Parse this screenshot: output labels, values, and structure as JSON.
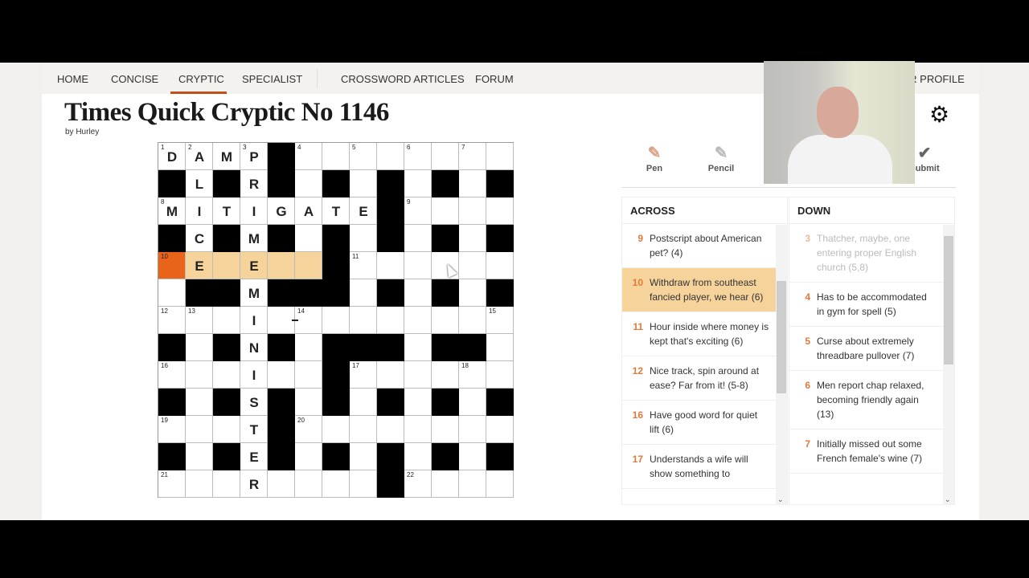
{
  "nav": {
    "items": [
      "HOME",
      "CONCISE",
      "CRYPTIC",
      "SPECIALIST",
      "CROSSWORD ARTICLES",
      "FORUM"
    ],
    "active": "CRYPTIC",
    "profile": "YOUR PROFILE"
  },
  "puzzle": {
    "title": "Times Quick Cryptic No 1146",
    "byline": "by Hurley"
  },
  "tools": {
    "pen": "Pen",
    "pencil": "Pencil",
    "submit": "Submit",
    "settings_icon": "gear-icon"
  },
  "grid": {
    "pattern": [
      "....#........",
      "#.#.#.#.#.#.#",
      "........#....",
      "#.#.#.#.#.#.#",
      "......#......",
      ".##.###.#.#.#",
      ".............",
      "#.#.#.###.##.",
      "......#......",
      "#.#.#.#.#.#.#",
      "....#........",
      "#.#.#.#.#.#.#",
      "........#...."
    ],
    "letters": {
      "0,0": "D",
      "0,1": "A",
      "0,2": "M",
      "0,3": "P",
      "1,1": "L",
      "1,3": "R",
      "2,0": "M",
      "2,1": "I",
      "2,2": "T",
      "2,3": "I",
      "2,4": "G",
      "2,5": "A",
      "2,6": "T",
      "2,7": "E",
      "3,1": "C",
      "3,3": "M",
      "4,1": "E",
      "4,3": "E",
      "5,3": "M",
      "6,3": "I",
      "7,3": "N",
      "8,3": "I",
      "9,3": "S",
      "10,3": "T",
      "11,3": "E",
      "12,3": "R"
    },
    "numbers": {
      "0,0": 1,
      "0,1": 2,
      "0,3": 3,
      "0,5": 4,
      "0,7": 5,
      "0,9": 6,
      "0,11": 7,
      "2,0": 8,
      "2,9": 9,
      "4,0": 10,
      "4,7": 11,
      "6,0": 12,
      "6,1": 13,
      "6,5": 14,
      "6,12": 15,
      "8,0": 16,
      "8,7": 17,
      "8,11": 18,
      "10,0": 19,
      "10,5": 20,
      "12,0": 21,
      "12,9": 22
    },
    "highlight": [
      "4,1",
      "4,2",
      "4,3",
      "4,4",
      "4,5"
    ],
    "current": "4,0",
    "colors": {
      "highlight": "#f7d39c",
      "current": "#e8641b"
    }
  },
  "across": {
    "title": "ACROSS",
    "clues": [
      {
        "n": "9",
        "text": "Postscript about American pet? (4)"
      },
      {
        "n": "10",
        "text": "Withdraw from southeast fancied player, we hear (6)",
        "selected": true
      },
      {
        "n": "11",
        "text": "Hour inside where money is kept that's exciting (6)"
      },
      {
        "n": "12",
        "text": "Nice track, spin around at ease? Far from it! (5-8)"
      },
      {
        "n": "16",
        "text": "Have good word for quiet lift (6)"
      },
      {
        "n": "17",
        "text": "Understands a wife will show something to"
      }
    ]
  },
  "down": {
    "title": "DOWN",
    "clues": [
      {
        "n": "3",
        "text": "Thatcher, maybe, one entering proper English church (5,8)",
        "done": true
      },
      {
        "n": "4",
        "text": "Has to be accommodated in gym for spell (5)"
      },
      {
        "n": "5",
        "text": "Curse about extremely threadbare pullover (7)"
      },
      {
        "n": "6",
        "text": "Men report chap relaxed, becoming friendly again (13)"
      },
      {
        "n": "7",
        "text": "Initially missed out some French female's wine (7)"
      }
    ]
  }
}
